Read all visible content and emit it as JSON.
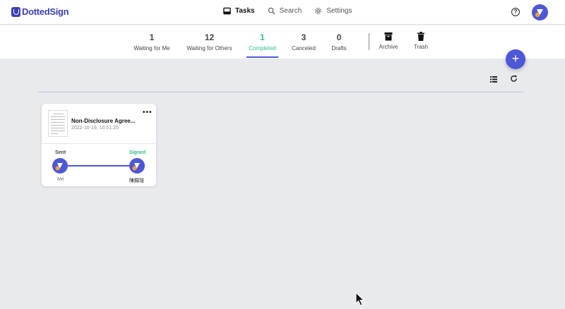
{
  "app": {
    "name": "DottedSign"
  },
  "nav": {
    "tasks": "Tasks",
    "search": "Search",
    "settings": "Settings"
  },
  "help": {
    "label": "?"
  },
  "tabs": [
    {
      "count": "1",
      "label": "Waiting for Me"
    },
    {
      "count": "12",
      "label": "Waiting for Others"
    },
    {
      "count": "1",
      "label": "Completed",
      "active": true
    },
    {
      "count": "3",
      "label": "Canceled"
    },
    {
      "count": "0",
      "label": "Drafts"
    }
  ],
  "extra_tabs": [
    {
      "label": "Archive",
      "icon": "archive-icon"
    },
    {
      "label": "Trash",
      "icon": "trash-icon"
    }
  ],
  "fab": {
    "label": "+"
  },
  "card": {
    "title": "Non-Disclosure Agree...",
    "date": "2022-10-19, 10:51:25",
    "menu": "•••",
    "sent_label": "Sent",
    "signed_label": "Signed",
    "sender": "Me",
    "signer": "陳鍚瑄"
  },
  "colors": {
    "accent": "#4e57d6",
    "success": "#2fbf84",
    "background": "#e9eaee",
    "avatar_orange": "#f2a23a"
  }
}
